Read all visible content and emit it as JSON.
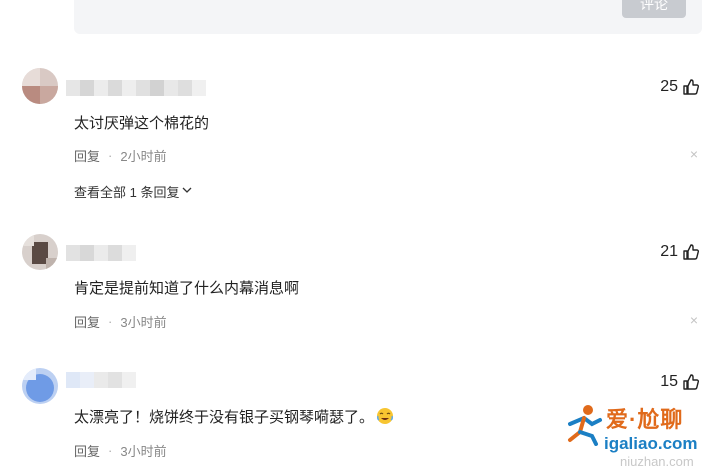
{
  "comment_box": {
    "submit_label": "评论"
  },
  "comments": [
    {
      "text": "太讨厌弹这个棉花的",
      "likes": "25",
      "reply_label": "回复",
      "time": "2小时前",
      "close": "×",
      "view_all": "查看全部 1 条回复"
    },
    {
      "text": "肯定是提前知道了什么内幕消息啊",
      "likes": "21",
      "reply_label": "回复",
      "time": "3小时前",
      "close": "×"
    },
    {
      "text": "太漂亮了！烧饼终于没有银子买钢琴嗬瑟了。",
      "likes": "15",
      "reply_label": "回复",
      "time": "3小时前"
    }
  ],
  "watermark": {
    "title": "爱·尬聊",
    "domain": "igaliao.com",
    "sub": "niuzhan.com"
  },
  "colors": {
    "accent_orange": "#e06a1b",
    "accent_blue": "#1b7fc4",
    "meta_gray": "#666666"
  }
}
